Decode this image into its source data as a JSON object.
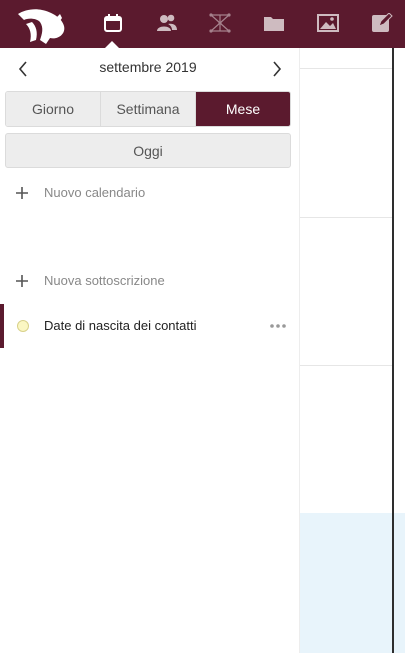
{
  "app": {
    "brand_color": "#5b1a2e",
    "nav_icons": [
      "calendar-icon",
      "contacts-icon",
      "network-icon",
      "files-icon",
      "gallery-icon",
      "notes-icon"
    ],
    "active_app": "calendar-icon"
  },
  "sidebar": {
    "month_label": "settembre 2019",
    "views": [
      {
        "label": "Giorno",
        "active": false
      },
      {
        "label": "Settimana",
        "active": false
      },
      {
        "label": "Mese",
        "active": true
      }
    ],
    "today_label": "Oggi",
    "new_calendar_label": "Nuovo calendario",
    "new_subscription_label": "Nuova sottoscrizione",
    "calendars": [
      {
        "name": "Date di nascita dei contatti",
        "color": "#fbf7c3",
        "more_icon": "more-icon"
      }
    ]
  },
  "main": {
    "today_highlight_color": "#e8f4fb"
  }
}
